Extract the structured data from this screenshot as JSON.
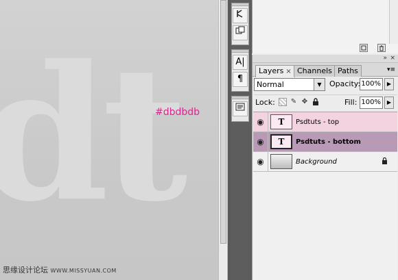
{
  "canvas": {
    "big_text": "dt",
    "color_label": "#dbdbdb",
    "text_color": "#dbdbdb",
    "label_color": "#e0248f"
  },
  "watermark": {
    "text": "思缘设计论坛",
    "site": "WWW.MISSYUAN.COM"
  },
  "toolstrip": {
    "icons": [
      "brush-preset-icon",
      "clone-source-icon",
      "character-icon",
      "paragraph-icon",
      "navigator-icon"
    ],
    "character_glyph": "A|",
    "paragraph_glyph": "¶"
  },
  "layers_panel": {
    "tabs": [
      {
        "label": "Layers",
        "active": true
      },
      {
        "label": "Channels",
        "active": false
      },
      {
        "label": "Paths",
        "active": false
      }
    ],
    "tab_close": "×",
    "blend_mode": "Normal",
    "opacity_label": "Opacity:",
    "opacity_value": "100%",
    "lock_label": "Lock:",
    "fill_label": "Fill:",
    "fill_value": "100%",
    "layers": [
      {
        "name": "Psdtuts - top",
        "type": "text",
        "glyph": "T",
        "selected": false
      },
      {
        "name": "Psdtuts - bottom",
        "type": "text",
        "glyph": "T",
        "selected": true
      },
      {
        "name": "Background",
        "type": "background",
        "glyph": "",
        "selected": false,
        "locked": true
      }
    ]
  },
  "colors": {
    "selected_row": "#b99ab6",
    "highlight_row": "#f4d3e1",
    "pink_label": "#e0248f"
  }
}
